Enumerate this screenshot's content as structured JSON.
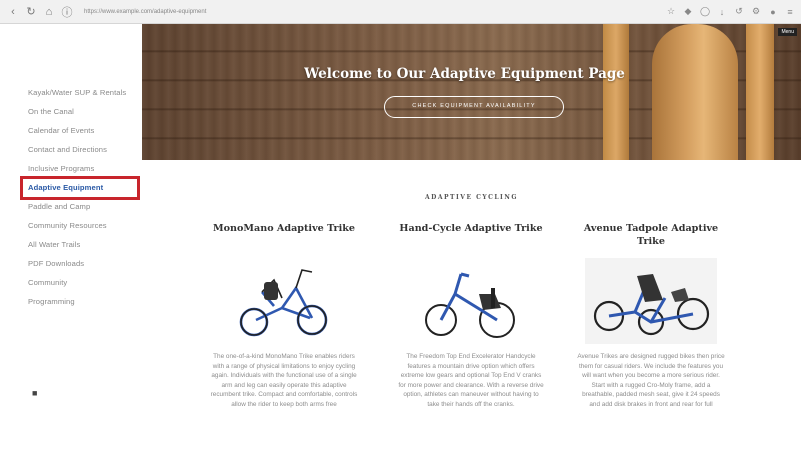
{
  "browser": {
    "url": "https://www.example.com/adaptive-equipment"
  },
  "sidebar": {
    "items": [
      {
        "label": "Kayak/Water SUP & Rentals"
      },
      {
        "label": "On the Canal"
      },
      {
        "label": "Calendar of Events"
      },
      {
        "label": "Contact and Directions"
      },
      {
        "label": "Inclusive Programs"
      },
      {
        "label": "Adaptive Equipment",
        "active": true
      },
      {
        "label": "Paddle and Camp"
      },
      {
        "label": "Community Resources"
      },
      {
        "label": "All Water Trails"
      },
      {
        "label": "PDF Downloads"
      },
      {
        "label": "Community"
      },
      {
        "label": "Programming"
      }
    ]
  },
  "hero": {
    "title": "Welcome to Our Adaptive Equipment Page",
    "button_label": "CHECK EQUIPMENT AVAILABILITY",
    "corner_label": "Menu"
  },
  "section": {
    "heading": "ADAPTIVE CYCLING"
  },
  "products": [
    {
      "title": "MonoMano Adaptive Trike",
      "description": "The one-of-a-kind MonoMano Trike enables riders with a range of physical limitations to enjoy cycling again. Individuals with the functional use of a single arm and leg can easily operate this adaptive recumbent trike. Compact and comfortable, controls allow the rider to keep both arms free"
    },
    {
      "title": "Hand-Cycle Adaptive Trike",
      "description": "The Freedom Top End Excelerator Handcycle features a mountain drive option which offers extreme low gears and optional Top End V cranks for more power and clearance. With a reverse drive option, athletes can maneuver without having to take their hands off the cranks."
    },
    {
      "title": "Avenue Tadpole Adaptive Trike",
      "description": "Avenue Trikes are designed rugged bikes then price them for casual riders. We include the features you will want when you become a more serious rider. Start with a rugged Cro-Moly frame, add a breathable, padded mesh seat, give it 24 speeds and add disk brakes in front and rear for full"
    }
  ],
  "colors": {
    "accent": "#2b5aa6",
    "highlight": "#c8252c",
    "bike_frame": "#2f58b0"
  }
}
